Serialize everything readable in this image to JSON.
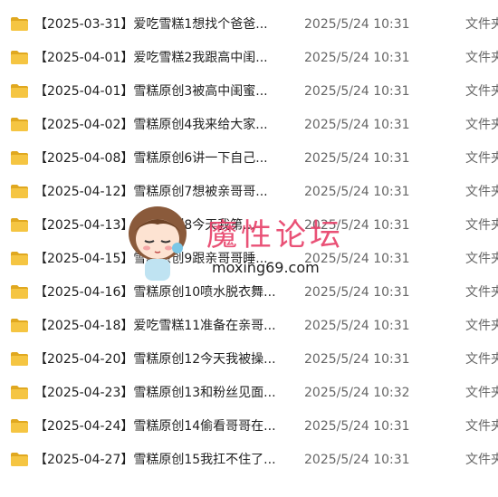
{
  "files": [
    {
      "name": "【2025-03-31】爱吃雪糕1想找个爸爸...",
      "date": "2025/5/24 10:31",
      "type": "文件夹"
    },
    {
      "name": "【2025-04-01】爱吃雪糕2我跟高中闺...",
      "date": "2025/5/24 10:31",
      "type": "文件夹"
    },
    {
      "name": "【2025-04-01】雪糕原创3被高中闺蜜...",
      "date": "2025/5/24 10:31",
      "type": "文件夹"
    },
    {
      "name": "【2025-04-02】雪糕原创4我来给大家...",
      "date": "2025/5/24 10:31",
      "type": "文件夹"
    },
    {
      "name": "【2025-04-08】雪糕原创6讲一下自己...",
      "date": "2025/5/24 10:31",
      "type": "文件夹"
    },
    {
      "name": "【2025-04-12】雪糕原创7想被亲哥哥...",
      "date": "2025/5/24 10:31",
      "type": "文件夹"
    },
    {
      "name": "【2025-04-13】雪糕原创8今天我第...",
      "date": "2025/5/24 10:31",
      "type": "文件夹"
    },
    {
      "name": "【2025-04-15】雪糕原创9跟亲哥哥睡...",
      "date": "2025/5/24 10:31",
      "type": "文件夹"
    },
    {
      "name": "【2025-04-16】雪糕原创10喷水脱衣舞...",
      "date": "2025/5/24 10:31",
      "type": "文件夹"
    },
    {
      "name": "【2025-04-18】爱吃雪糕11准备在亲哥...",
      "date": "2025/5/24 10:31",
      "type": "文件夹"
    },
    {
      "name": "【2025-04-20】雪糕原创12今天我被操...",
      "date": "2025/5/24 10:31",
      "type": "文件夹"
    },
    {
      "name": "【2025-04-23】雪糕原创13和粉丝见面...",
      "date": "2025/5/24 10:32",
      "type": "文件夹"
    },
    {
      "name": "【2025-04-24】雪糕原创14偷看哥哥在...",
      "date": "2025/5/24 10:31",
      "type": "文件夹"
    },
    {
      "name": "【2025-04-27】雪糕原创15我扛不住了...",
      "date": "2025/5/24 10:31",
      "type": "文件夹"
    }
  ],
  "watermark": {
    "title": "魔性论坛",
    "url": "moxing69.com"
  },
  "colors": {
    "folder": "#f5c542",
    "folder_dark": "#e0a820",
    "watermark": "#e8436b"
  }
}
